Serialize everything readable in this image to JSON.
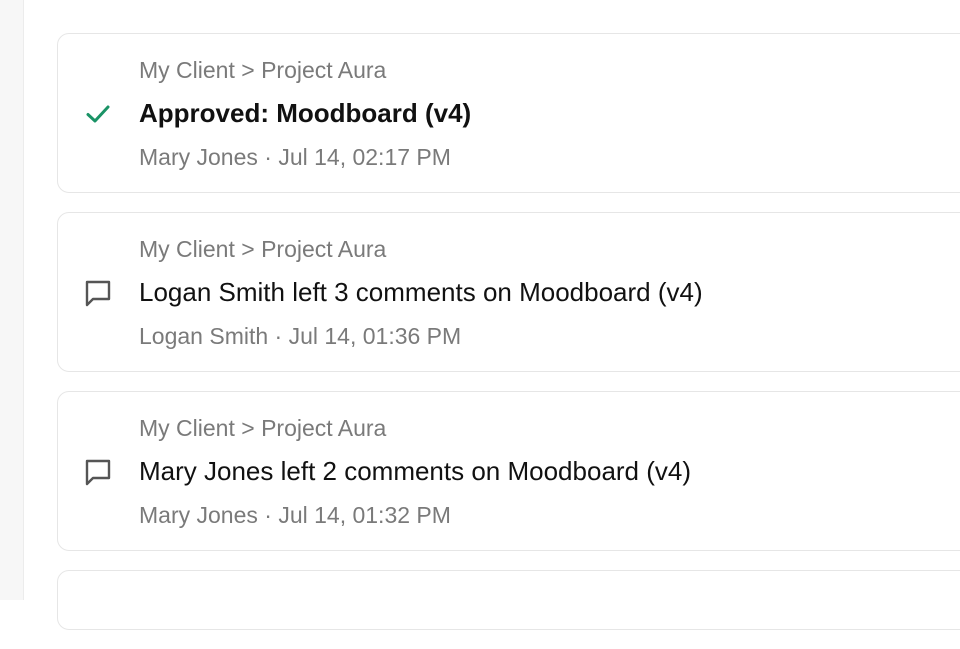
{
  "colors": {
    "approved_check": "#1a9366",
    "comment_icon": "#555555",
    "muted_text": "#7a7a7a",
    "title_text": "#111111"
  },
  "activity": [
    {
      "icon": "check-icon",
      "breadcrumb": "My Client > Project Aura",
      "title": "Approved: Moodboard (v4)",
      "meta": "Mary Jones · Jul 14, 02:17 PM"
    },
    {
      "icon": "comment-icon",
      "breadcrumb": "My Client > Project Aura",
      "title": "Logan Smith left 3 comments on Moodboard (v4)",
      "meta": "Logan Smith · Jul 14, 01:36 PM"
    },
    {
      "icon": "comment-icon",
      "breadcrumb": "My Client > Project Aura",
      "title": "Mary Jones left 2 comments on Moodboard (v4)",
      "meta": "Mary Jones · Jul 14, 01:32 PM"
    }
  ]
}
